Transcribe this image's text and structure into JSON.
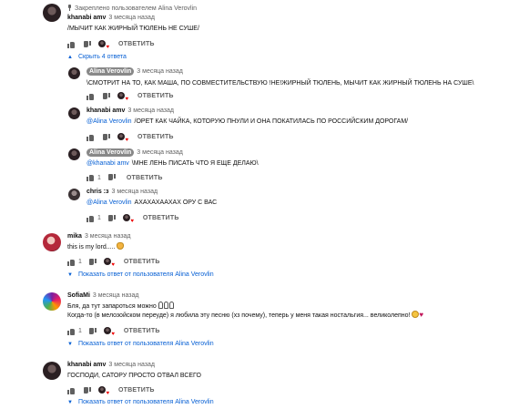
{
  "ui": {
    "reply_label": "ОТВЕТИТЬ",
    "accent": "#065fd4",
    "heart_color": "#e00000"
  },
  "c1": {
    "pinned": "Закреплено пользователем Alina Verovlin",
    "author": "khanabi amv",
    "time": "3 месяца назад",
    "text": "/МЫЧИТ КАК ЖИРНЫЙ ТЮЛЕНЬ НЕ СУШЕ/",
    "toggle": "Скрыть 4 ответа"
  },
  "r1": {
    "author": "Alina Verovlin",
    "time": "3 месяца назад",
    "text": "\\СМОТРИТ НА ТО, КАК МАША, ПО СОВМЕСТИТЕЛЬСТВУЮ !НЕ!ЖИРНЫЙ ТЮЛЕНЬ, МЫЧИТ КАК ЖИРНЫЙ ТЮЛЕНЬ НА СУШЕ\\"
  },
  "r2": {
    "author": "khanabi amv",
    "time": "3 месяца назад",
    "mention": "@Alina Verovlin",
    "text": "/ОРЕТ КАК ЧАЙКА, КОТОРУЮ ПНУЛИ И ОНА ПОКАТИЛАСЬ ПО РОССИЙСКИМ ДОРОГАМ/"
  },
  "r3": {
    "author": "Alina Verovlin",
    "time": "3 месяца назад",
    "mention": "@khanabi amv",
    "text": "\\МНЕ ЛЕНЬ ПИСАТЬ ЧТО Я ЕЩЕ ДЕЛАЮ\\",
    "likes": "1"
  },
  "r4": {
    "author": "chris :з",
    "time": "3 месяца назад",
    "mention": "@Alina Verovlin",
    "text": "АХАХАХААХАХ ОРУ С ВАС",
    "likes": "1"
  },
  "c2": {
    "author": "mika",
    "time": "3 месяца назад",
    "text": "this is my lord.....",
    "likes": "1",
    "toggle": "Показать ответ от пользователя Alina Verovlin"
  },
  "c3": {
    "author": "SofiaMi",
    "time": "3 месяца назад",
    "line1": "Бля, да тут запароться можно",
    "line2": "Когда-то (в мелозойском переуде) я любила эту песню (хз почему), теперь у меня такая ностальгия... великолепно!",
    "likes": "1",
    "toggle": "Показать ответ от пользователя Alina Verovlin"
  },
  "c4": {
    "author": "khanabi amv",
    "time": "3 месяца назад",
    "text": "ГОСПОДИ, САТОРУ ПРОСТО ОТВАЛ ВСЕГО",
    "toggle": "Показать ответ от пользователя Alina Verovlin"
  }
}
